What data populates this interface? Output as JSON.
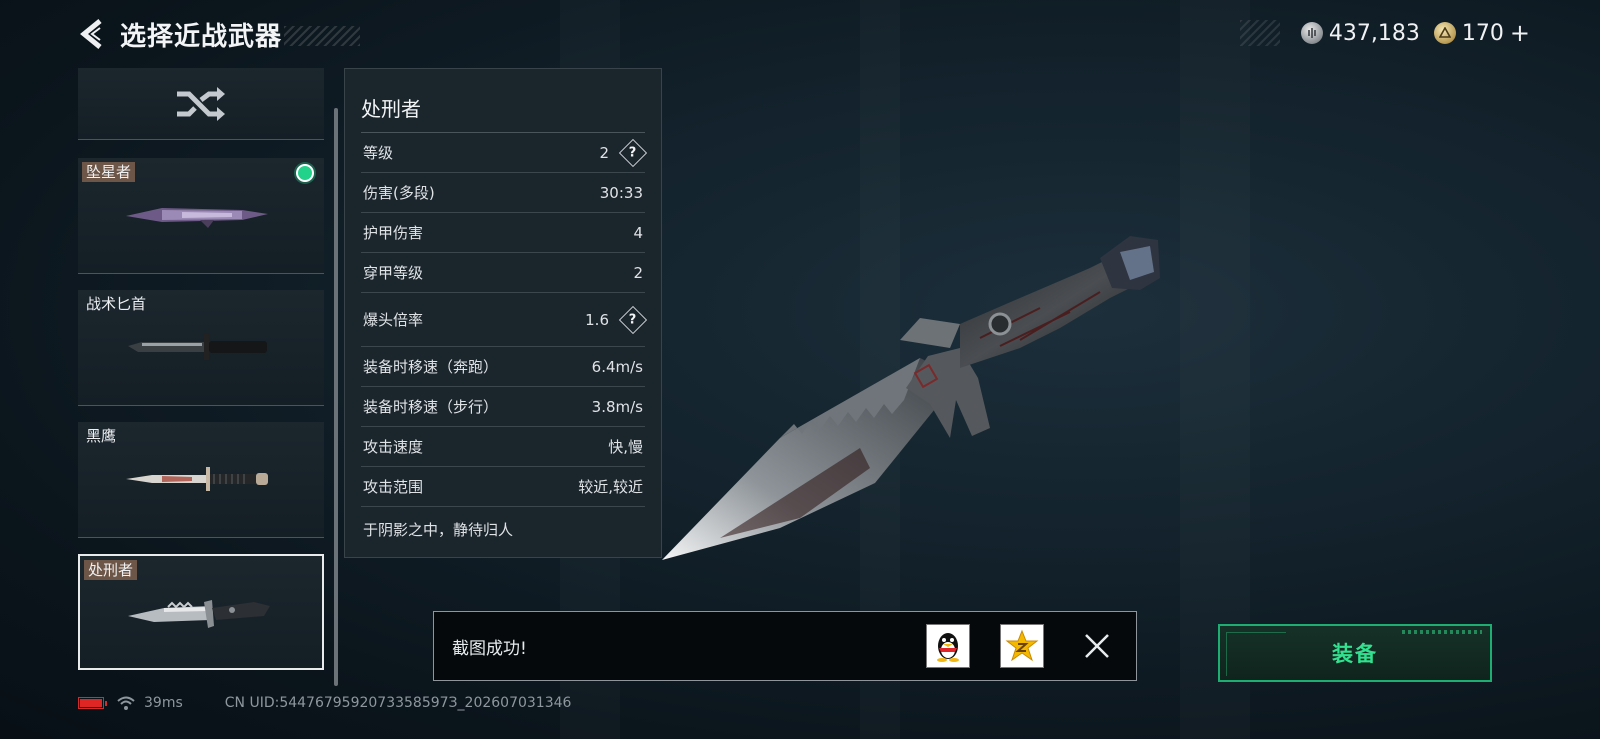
{
  "header": {
    "title": "选择近战武器"
  },
  "currency": [
    {
      "name": "silver-coin",
      "value": "437,183"
    },
    {
      "name": "gold-coin",
      "value": "170"
    }
  ],
  "currency_plus": "+",
  "weapon_list": [
    {
      "id": "random",
      "label": "",
      "icon": "shuffle-icon"
    },
    {
      "id": "starfall",
      "label": "坠星者",
      "tagged": true,
      "equipped": true
    },
    {
      "id": "tactical",
      "label": "战术匕首",
      "tagged": false
    },
    {
      "id": "blackhawk",
      "label": "黑鹰",
      "tagged": false
    },
    {
      "id": "executioner",
      "label": "处刑者",
      "tagged": true,
      "selected": true
    }
  ],
  "stats": {
    "title": "处刑者",
    "rows": [
      {
        "label": "等级",
        "value": "2",
        "help": true
      },
      {
        "label": "伤害(多段)",
        "value": "30:33"
      },
      {
        "label": "护甲伤害",
        "value": "4"
      },
      {
        "label": "穿甲等级",
        "value": "2"
      },
      {
        "label": "爆头倍率",
        "value": "1.6",
        "help": true
      },
      {
        "label": "装备时移速（奔跑）",
        "value": "6.4m/s"
      },
      {
        "label": "装备时移速（步行）",
        "value": "3.8m/s"
      },
      {
        "label": "攻击速度",
        "value": "快,慢"
      },
      {
        "label": "攻击范围",
        "value": "较近,较近"
      }
    ],
    "help_glyph": "?",
    "flavor": "于阴影之中，静待归人"
  },
  "toast": {
    "text": "截图成功!"
  },
  "equip_button": {
    "label": "装备"
  },
  "footer": {
    "ping": "39ms",
    "uid": "CN UID:5447679592073358597З_202607031346"
  },
  "colors": {
    "accent_green": "#33e08f",
    "equipped_dot": "#22d28b",
    "battery_red": "#e02525"
  }
}
